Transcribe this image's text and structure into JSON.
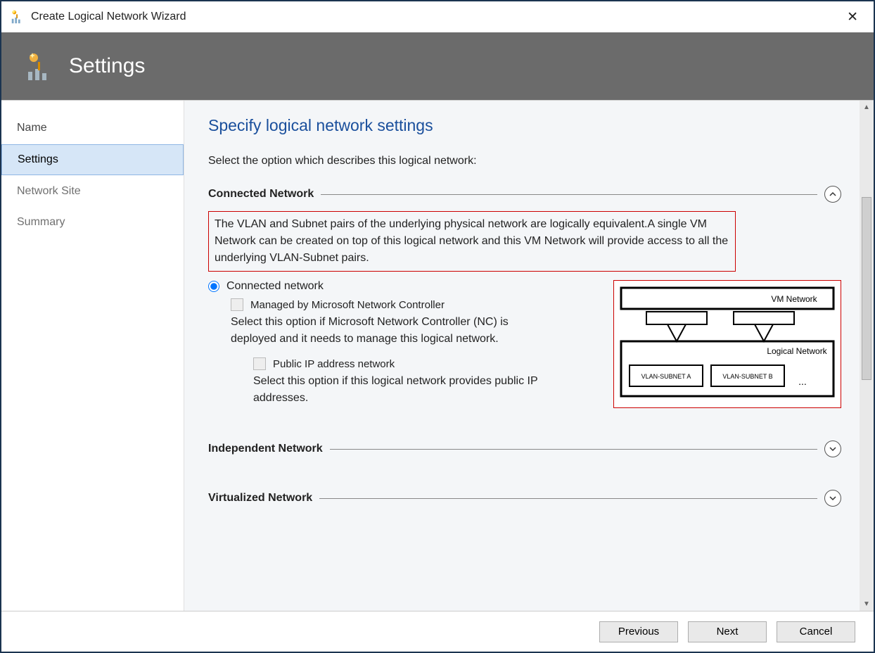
{
  "titlebar": {
    "title": "Create Logical Network Wizard"
  },
  "header": {
    "title": "Settings"
  },
  "sidebar": {
    "steps": [
      {
        "label": "Name",
        "active": false
      },
      {
        "label": "Settings",
        "active": true
      },
      {
        "label": "Network Site",
        "active": false,
        "inactive": true
      },
      {
        "label": "Summary",
        "active": false,
        "inactive": true
      }
    ]
  },
  "content": {
    "heading": "Specify logical network settings",
    "subtext": "Select the option which describes this logical network:",
    "section1": {
      "title": "Connected Network",
      "description": "The VLAN and Subnet pairs of the underlying physical network are logically equivalent.A single VM Network can be created on top of this logical network and this VM Network will provide access to all the underlying VLAN-Subnet pairs.",
      "radio_label": "Connected network",
      "checkbox1_label": "Managed by Microsoft Network Controller",
      "helper1": "Select this option if Microsoft Network Controller (NC) is deployed and it needs to manage this logical network.",
      "checkbox2_label": "Public IP address network",
      "helper2": "Select this option if this logical network provides public IP addresses.",
      "diagram": {
        "vm_network": "VM Network",
        "logical_network": "Logical Network",
        "vlan_a": "VLAN-SUBNET A",
        "vlan_b": "VLAN-SUBNET B",
        "ellipsis": "..."
      }
    },
    "section2": {
      "title": "Independent Network"
    },
    "section3": {
      "title": "Virtualized Network"
    }
  },
  "footer": {
    "previous": "Previous",
    "next": "Next",
    "cancel": "Cancel"
  }
}
